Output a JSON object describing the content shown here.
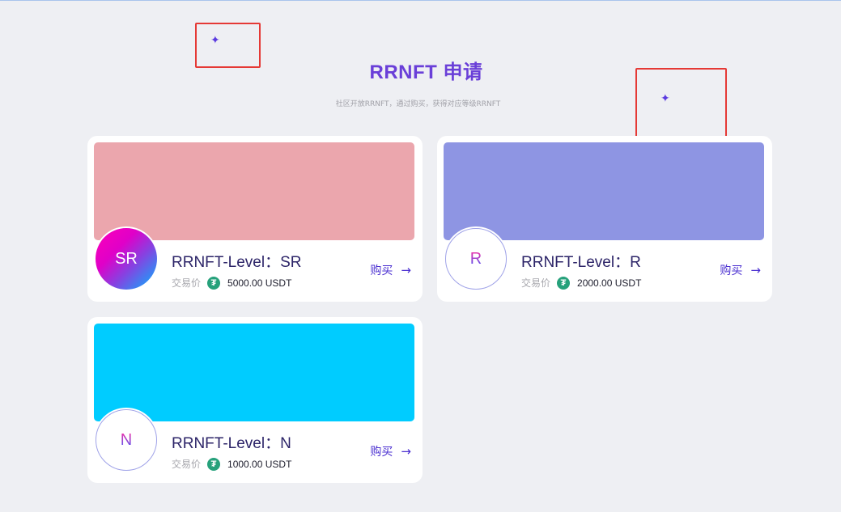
{
  "header": {
    "title": "RRNFT 申请",
    "subtitle": "社区开放RRNFT，通过购买，获得对应等级RRNFT"
  },
  "decor": {
    "sparkle_glyph": "✦"
  },
  "cards": [
    {
      "badge": "SR",
      "name": "RRNFT-Level：SR",
      "price_label": "交易价",
      "currency_icon": "usdt-icon",
      "currency_glyph": "₮",
      "price": "5000.00 USDT",
      "buy_label": "购买",
      "arrow": "→",
      "banner_color": "#eba6ad"
    },
    {
      "badge": "R",
      "name": "RRNFT-Level：R",
      "price_label": "交易价",
      "currency_icon": "usdt-icon",
      "currency_glyph": "₮",
      "price": "2000.00 USDT",
      "buy_label": "购买",
      "arrow": "→",
      "banner_color": "#8e95e3"
    },
    {
      "badge": "N",
      "name": "RRNFT-Level：N",
      "price_label": "交易价",
      "currency_icon": "usdt-icon",
      "currency_glyph": "₮",
      "price": "1000.00 USDT",
      "buy_label": "购买",
      "arrow": "→",
      "banner_color": "#00ccff"
    }
  ]
}
